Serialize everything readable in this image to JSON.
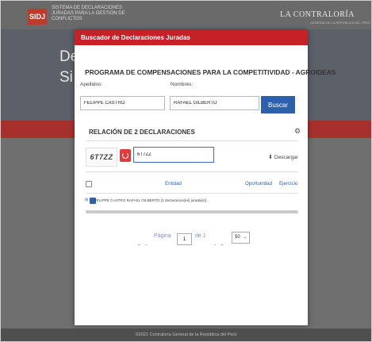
{
  "background": {
    "logo": "SIDJ",
    "logo_text": "SISTEMA DE DECLARACIONES JURADAS PARA LA GESTIÓN DE CONFLICTOS",
    "brand": "LA CONTRALORÍA",
    "brand_sub": "GENERAL DE LA REPÚBLICA DEL PERÚ",
    "hero_title_line1": "De",
    "hero_title_line2": "Si",
    "footer": "©2021 Contraloría General de la República del Perú"
  },
  "modal": {
    "title": "Buscador de Declaraciones Juradas",
    "program_title": "PROGRAMA DE COMPENSACIONES PARA LA COMPETITIVIDAD - AGROIDEAS",
    "apellidos_label": "Apellidos:",
    "apellidos_value": "FELIPPE CASTRO",
    "nombres_label": "Nombres:",
    "nombres_value": "RAFAEL GILBERTO",
    "search_button": "Buscar",
    "relacion_title": "RELACIÓN DE 2 DECLARACIONES",
    "captcha_text": "6T7ZZ",
    "captcha_input": "6T7ZZ",
    "download_label": "Descargar",
    "table": {
      "columns": [
        "Entidad",
        "Oportunidad",
        "Ejercicio"
      ],
      "rows": [
        {
          "text": "FELIPPE CASTRO RAFAEL GILBERTO (2 declaracion(es) jurada(s))"
        }
      ]
    },
    "pager": {
      "first": "⇤",
      "prev": "⇠",
      "page_label": "Página",
      "current_page": "1",
      "of_label": "de 1",
      "next": "⇢",
      "last": "⇥",
      "per_page": "50"
    }
  },
  "colors": {
    "modal_header": "#c72128",
    "accent_blue": "#2d61ad"
  }
}
